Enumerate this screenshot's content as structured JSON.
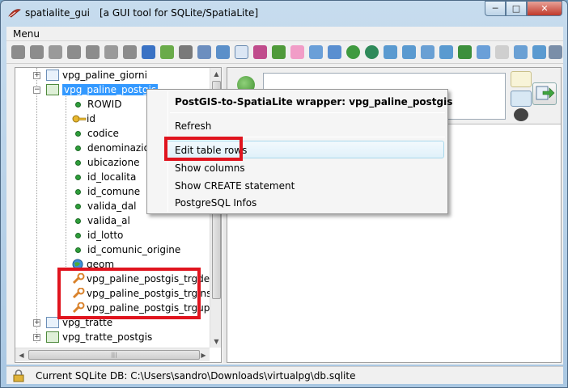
{
  "window": {
    "title": "spatialite_gui",
    "subtitle": "[a GUI tool for SQLite/SpatiaLite]",
    "controls": {
      "minimize": "─",
      "maximize": "□",
      "close": "✕"
    }
  },
  "menubar": {
    "items": [
      {
        "label": "Menu"
      }
    ]
  },
  "tree": {
    "items": [
      {
        "label": "vpg_paline_giorni",
        "icon": "table-icon"
      },
      {
        "label": "vpg_paline_postgis",
        "icon": "spatial-table-icon",
        "selected": true
      },
      {
        "label": "ROWID",
        "icon": "column-dot-icon"
      },
      {
        "label": "id",
        "icon": "primary-key-icon"
      },
      {
        "label": "codice",
        "icon": "column-dot-icon"
      },
      {
        "label": "denominazione",
        "icon": "column-dot-icon"
      },
      {
        "label": "ubicazione",
        "icon": "column-dot-icon"
      },
      {
        "label": "id_localita",
        "icon": "column-dot-icon"
      },
      {
        "label": "id_comune",
        "icon": "column-dot-icon"
      },
      {
        "label": "valida_dal",
        "icon": "column-dot-icon"
      },
      {
        "label": "valida_al",
        "icon": "column-dot-icon"
      },
      {
        "label": "id_lotto",
        "icon": "column-dot-icon"
      },
      {
        "label": "id_comunic_origine",
        "icon": "column-dot-icon"
      },
      {
        "label": "geom",
        "icon": "geometry-globe-icon"
      },
      {
        "label": "vpg_paline_postgis_trgdel",
        "icon": "trigger-icon"
      },
      {
        "label": "vpg_paline_postgis_trgins",
        "icon": "trigger-icon"
      },
      {
        "label": "vpg_paline_postgis_trgupd",
        "icon": "trigger-icon"
      },
      {
        "label": "vpg_tratte",
        "icon": "table-icon"
      },
      {
        "label": "vpg_tratte_postgis",
        "icon": "spatial-table-icon"
      }
    ]
  },
  "context_menu": {
    "title": "PostGIS-to-SpatiaLite wrapper: vpg_paline_postgis",
    "items": [
      {
        "label": "Refresh"
      },
      {
        "label": "Edit table rows",
        "highlighted": true
      },
      {
        "label": "Show columns"
      },
      {
        "label": "Show CREATE statement"
      },
      {
        "label": "PostgreSQL Infos"
      }
    ]
  },
  "statusbar": {
    "text": "Current SQLite DB: C:\\Users\\sandro\\Downloads\\virtualpg\\db.sqlite"
  },
  "colors": {
    "selection": "#3399ff",
    "highlight_box": "#e0141e",
    "column_dot": "#2e9e3a"
  }
}
